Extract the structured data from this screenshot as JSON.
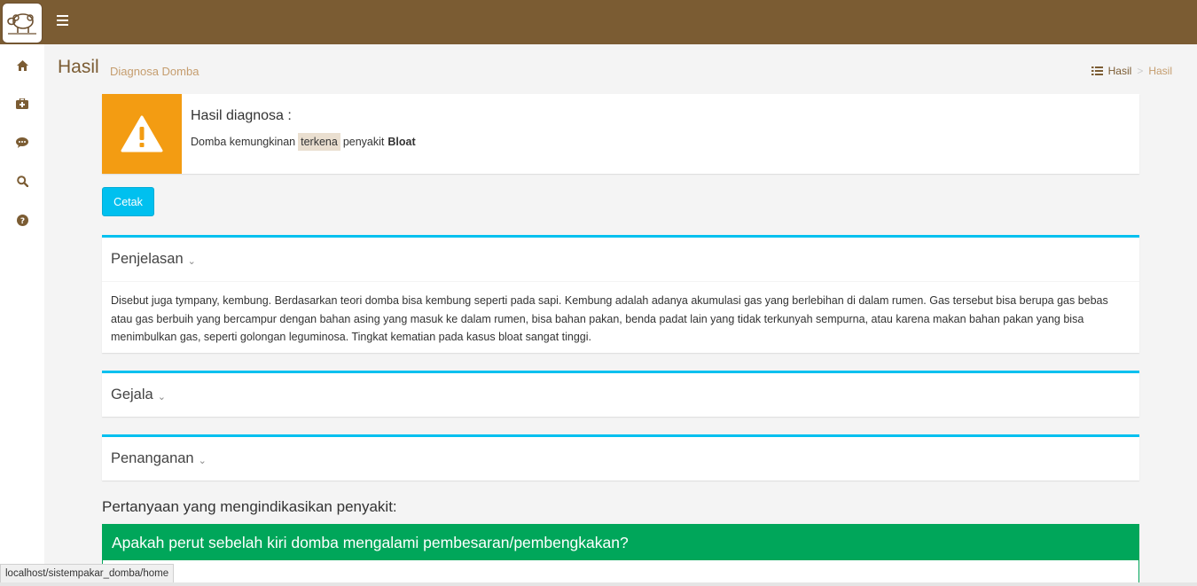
{
  "header": {
    "logo_icon": "sheep-icon",
    "menu_icon": "hamburger-icon"
  },
  "sidebar": {
    "items": [
      {
        "icon": "home-icon"
      },
      {
        "icon": "medkit-icon"
      },
      {
        "icon": "comments-icon"
      },
      {
        "icon": "search-icon"
      },
      {
        "icon": "question-circle-icon"
      }
    ]
  },
  "page": {
    "title": "Hasil",
    "subtitle": "Diagnosa Domba",
    "breadcrumb": [
      "Hasil",
      "Hasil"
    ]
  },
  "result": {
    "title": "Hasil diagnosa :",
    "text_before": "Domba kemungkinan",
    "highlight": "terkena",
    "text_middle": "penyakit",
    "disease": "Bloat",
    "icon": "warning-icon",
    "color": "#f39c12"
  },
  "actions": {
    "print_label": "Cetak"
  },
  "sections": {
    "penjelasan": {
      "title": "Penjelasan",
      "body": "Disebut juga tympany, kembung. Berdasarkan teori domba bisa kembung seperti pada sapi. Kembung adalah adanya akumulasi gas yang berlebihan di dalam rumen. Gas tersebut bisa berupa gas bebas atau gas berbuih yang bercampur dengan bahan asing yang masuk ke dalam rumen, bisa bahan pakan, benda padat lain yang tidak terkunyah sempurna, atau karena makan bahan pakan yang bisa menimbulkan gas, seperti golongan leguminosa. Tingkat kematian pada kasus bloat sangat tinggi."
    },
    "gejala": {
      "title": "Gejala"
    },
    "penanganan": {
      "title": "Penanganan"
    }
  },
  "questions": {
    "label": "Pertanyaan yang mengindikasikan penyakit:",
    "items": [
      {
        "text": "Apakah perut sebelah kiri domba mengalami pembesaran/pembengkakan?"
      }
    ]
  },
  "status_bar": {
    "url": "localhost/sistempakar_domba/home"
  },
  "colors": {
    "brand": "#7b5c33",
    "accent": "#00c0ef",
    "success": "#00a65a",
    "warning": "#f39c12"
  }
}
